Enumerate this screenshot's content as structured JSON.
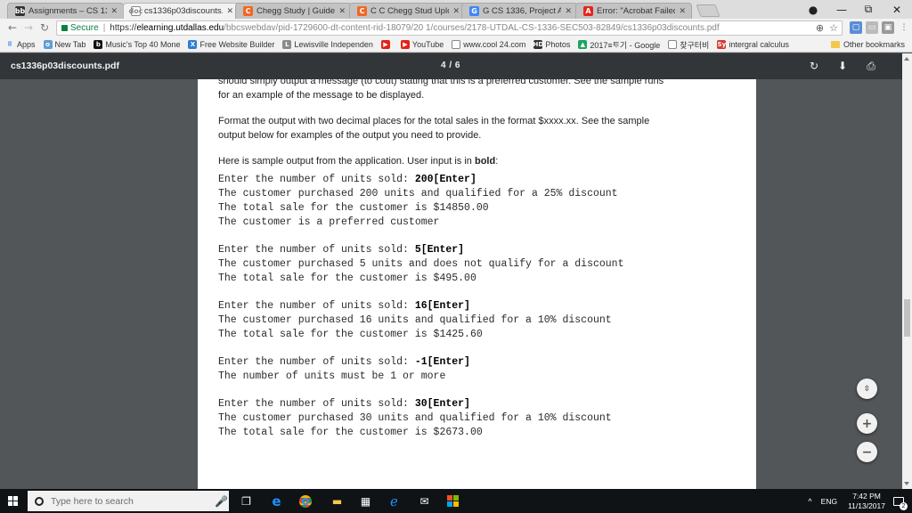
{
  "tabs": [
    {
      "title": "Assignments – CS 1336.5",
      "favicon": "bb",
      "color": "#333333",
      "active": false
    },
    {
      "title": "cs1336p03discounts.pdf",
      "favicon": "doc",
      "color": "#ffffff",
      "active": true
    },
    {
      "title": "Chegg Study | Guided So",
      "favicon": "C",
      "color": "#f26722",
      "active": false
    },
    {
      "title": "C C Chegg Stud Upload q",
      "favicon": "C",
      "color": "#f26722",
      "active": false
    },
    {
      "title": "G CS 1336, Project Assignm",
      "favicon": "G",
      "color": "#4285f4",
      "active": false
    },
    {
      "title": "Error: \"Acrobat Failed to",
      "favicon": "A",
      "color": "#e8231e",
      "active": false
    }
  ],
  "window": {
    "account": "●",
    "minimize": "—",
    "restore": "⧉",
    "close": "✕"
  },
  "omnibox": {
    "secure_label": "Secure",
    "url_scheme": "https://",
    "url_host": "elearning.utdallas.edu",
    "url_path": "/bbcswebdav/pid-1729600-dt-content-rid-18079/20 1/courses/2178-UTDAL-CS-1336-SEC503-82849/cs1336p03discounts.pdf"
  },
  "bookmarks": [
    {
      "label": "Apps",
      "icon": "grid",
      "color": "#4285f4"
    },
    {
      "label": "New Tab",
      "icon": "o",
      "color": "#5f9ed6"
    },
    {
      "label": "Music's Top 40 Mone",
      "icon": "b",
      "color": "#111111"
    },
    {
      "label": "Free Website Builder",
      "icon": "X",
      "color": "#2d7fd3"
    },
    {
      "label": "Lewisville Independen",
      "icon": "L",
      "color": "#8a8a8a"
    },
    {
      "label": "",
      "icon": "▶",
      "color": "#e62117"
    },
    {
      "label": "YouTube",
      "icon": "▶",
      "color": "#e62117"
    },
    {
      "label": "www.cool 24.com",
      "icon": "doc",
      "color": "#ffffff"
    },
    {
      "label": "Photos",
      "icon": "HD",
      "color": "#333333"
    },
    {
      "label": "2017≡ᄐᆞ기 - Google",
      "icon": "▲",
      "color": "#1fa463"
    },
    {
      "label": "찾구터비",
      "icon": "doc",
      "color": "#ffffff"
    },
    {
      "label": "intergral calculus",
      "icon": "Sy",
      "color": "#d23b2e"
    }
  ],
  "bookmarks_other": "Other bookmarks",
  "pdf": {
    "filename": "cs1336p03discounts.pdf",
    "page_indicator": "4 / 6",
    "prose1a": "should simply output a message (to cout) stating that this is a preferred customer. See the sample runs",
    "prose1b": "for an example of the message to be displayed.",
    "prose2a": "Format the output with two decimal places for the total sales in the format $xxxx.xx. See the sample",
    "prose2b": "output below for examples of the output you need to provide.",
    "prose3": "Here is sample output from the application. User input is in ",
    "prose3_bold": "bold",
    "prose3_end": ":",
    "runs": [
      {
        "prompt": "Enter the number of units sold: ",
        "input": "200[Enter]",
        "lines": [
          "The customer purchased 200 units and qualified for a 25% discount",
          "The total sale for the customer is $14850.00",
          "The customer is a preferred customer"
        ]
      },
      {
        "prompt": "Enter the number of units sold: ",
        "input": "5[Enter]",
        "lines": [
          "The customer purchased 5 units and does not qualify for a discount",
          "The total sale for the customer is $495.00"
        ]
      },
      {
        "prompt": "Enter the number of units sold: ",
        "input": "16[Enter]",
        "lines": [
          "The customer purchased 16 units and qualified for a 10% discount",
          "The total sale for the customer is $1425.60"
        ]
      },
      {
        "prompt": "Enter the number of units sold: ",
        "input": "-1[Enter]",
        "lines": [
          "The number of units must be 1 or more"
        ]
      },
      {
        "prompt": "Enter the number of units sold: ",
        "input": "30[Enter]",
        "lines": [
          "The customer purchased 30 units and qualified for a 10% discount",
          "The total sale for the customer is $2673.00"
        ]
      }
    ]
  },
  "taskbar": {
    "search_placeholder": "Type here to search",
    "language": "ENG",
    "time": "7:42 PM",
    "date": "11/13/2017",
    "notifications": "2"
  }
}
